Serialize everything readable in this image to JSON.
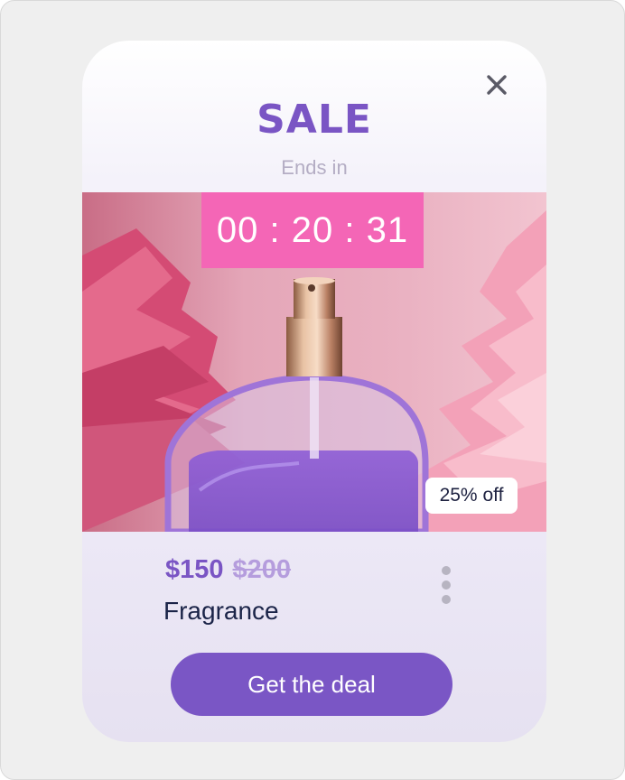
{
  "promo": {
    "title": "SALE",
    "ends_label": "Ends in",
    "countdown": "00 : 20 : 31",
    "discount_badge": "25% off",
    "price": "$150",
    "original_price": "$200",
    "product_name": "Fragrance",
    "cta_label": "Get the deal"
  },
  "icons": {
    "close": "close-icon",
    "more": "more-vertical-icon"
  },
  "colors": {
    "accent": "#7a55c4",
    "timer_bg": "#f466b6",
    "text_dark": "#1b2448",
    "muted": "#b4adc4"
  }
}
